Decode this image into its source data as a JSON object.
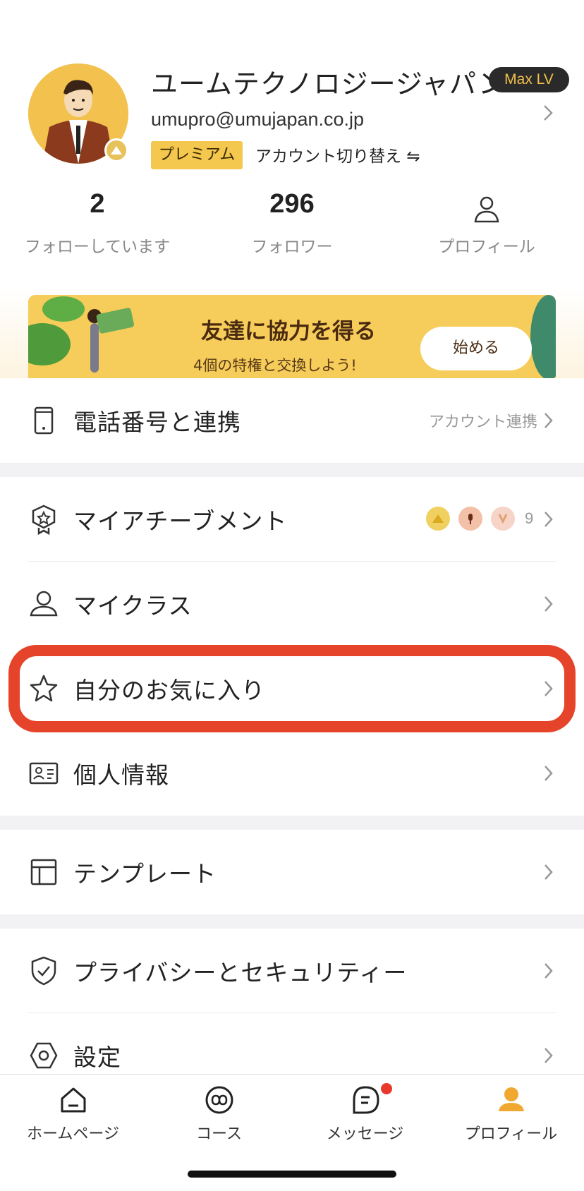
{
  "profile": {
    "name": "ユームテクノロジージャパン",
    "level": "Max LV",
    "email": "umupro@umujapan.co.jp",
    "plan": "プレミアム",
    "switch_account": "アカウント切り替え ⇋"
  },
  "stats": [
    {
      "value": "2",
      "label": "フォローしています"
    },
    {
      "value": "296",
      "label": "フォロワー"
    },
    {
      "value": "",
      "label": "プロフィール"
    }
  ],
  "banner": {
    "title": "友達に協力を得る",
    "subtitle": "4個の特権と交換しよう!",
    "button": "始める"
  },
  "menu": {
    "phone": {
      "label": "電話番号と連携",
      "right": "アカウント連携"
    },
    "achievement": {
      "label": "マイアチーブメント",
      "count": "9"
    },
    "myclass": {
      "label": "マイクラス"
    },
    "favorites": {
      "label": "自分のお気に入り"
    },
    "personal": {
      "label": "個人情報"
    },
    "template": {
      "label": "テンプレート"
    },
    "privacy": {
      "label": "プライバシーとセキュリティー"
    },
    "settings": {
      "label": "設定"
    }
  },
  "tabs": [
    {
      "label": "ホームページ",
      "icon": "home-icon"
    },
    {
      "label": "コース",
      "icon": "infinity-icon"
    },
    {
      "label": "メッセージ",
      "icon": "message-icon"
    },
    {
      "label": "プロフィール",
      "icon": "person-icon"
    }
  ],
  "colors": {
    "accent": "#f4c84f",
    "highlight": "#e5442b",
    "active_tab": "#f0a830",
    "notification": "#e8392b"
  }
}
